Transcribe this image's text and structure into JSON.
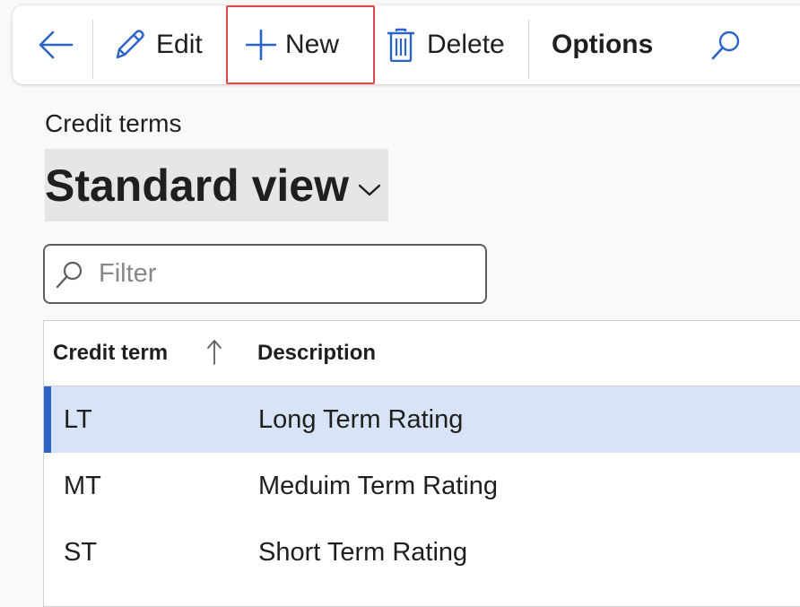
{
  "toolbar": {
    "back_icon": "arrow-left-icon",
    "edit_icon": "pencil-icon",
    "edit_label": "Edit",
    "new_icon": "plus-icon",
    "new_label": "New",
    "delete_icon": "trash-icon",
    "delete_label": "Delete",
    "options_label": "Options",
    "search_icon": "search-icon",
    "accent_color": "#2b63c9",
    "highlight_color": "#e0474c"
  },
  "page": {
    "caption": "Credit terms",
    "view_name": "Standard view"
  },
  "filter": {
    "placeholder": "Filter"
  },
  "grid": {
    "columns": [
      "Credit term",
      "Description"
    ],
    "sort_column": "Credit term",
    "sort_direction": "ascending",
    "rows": [
      {
        "code": "LT",
        "description": "Long Term Rating",
        "selected": true
      },
      {
        "code": "MT",
        "description": "Meduim Term Rating",
        "selected": false
      },
      {
        "code": "ST",
        "description": "Short Term Rating",
        "selected": false
      }
    ],
    "selected_color": "#d7e3f7"
  }
}
